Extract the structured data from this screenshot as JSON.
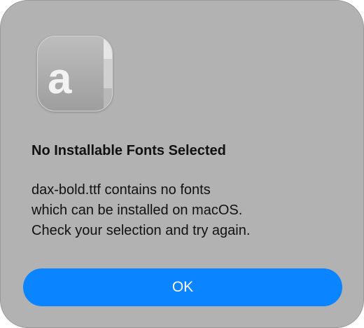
{
  "dialog": {
    "icon": "font-file-icon",
    "icon_glyph": "a",
    "title": "No Installable Fonts Selected",
    "message_lines": [
      "dax-bold.ttf contains no fonts",
      "which can be installed on macOS.",
      "Check your selection and try again."
    ],
    "ok_label": "OK",
    "accent": "#0a84ff"
  }
}
